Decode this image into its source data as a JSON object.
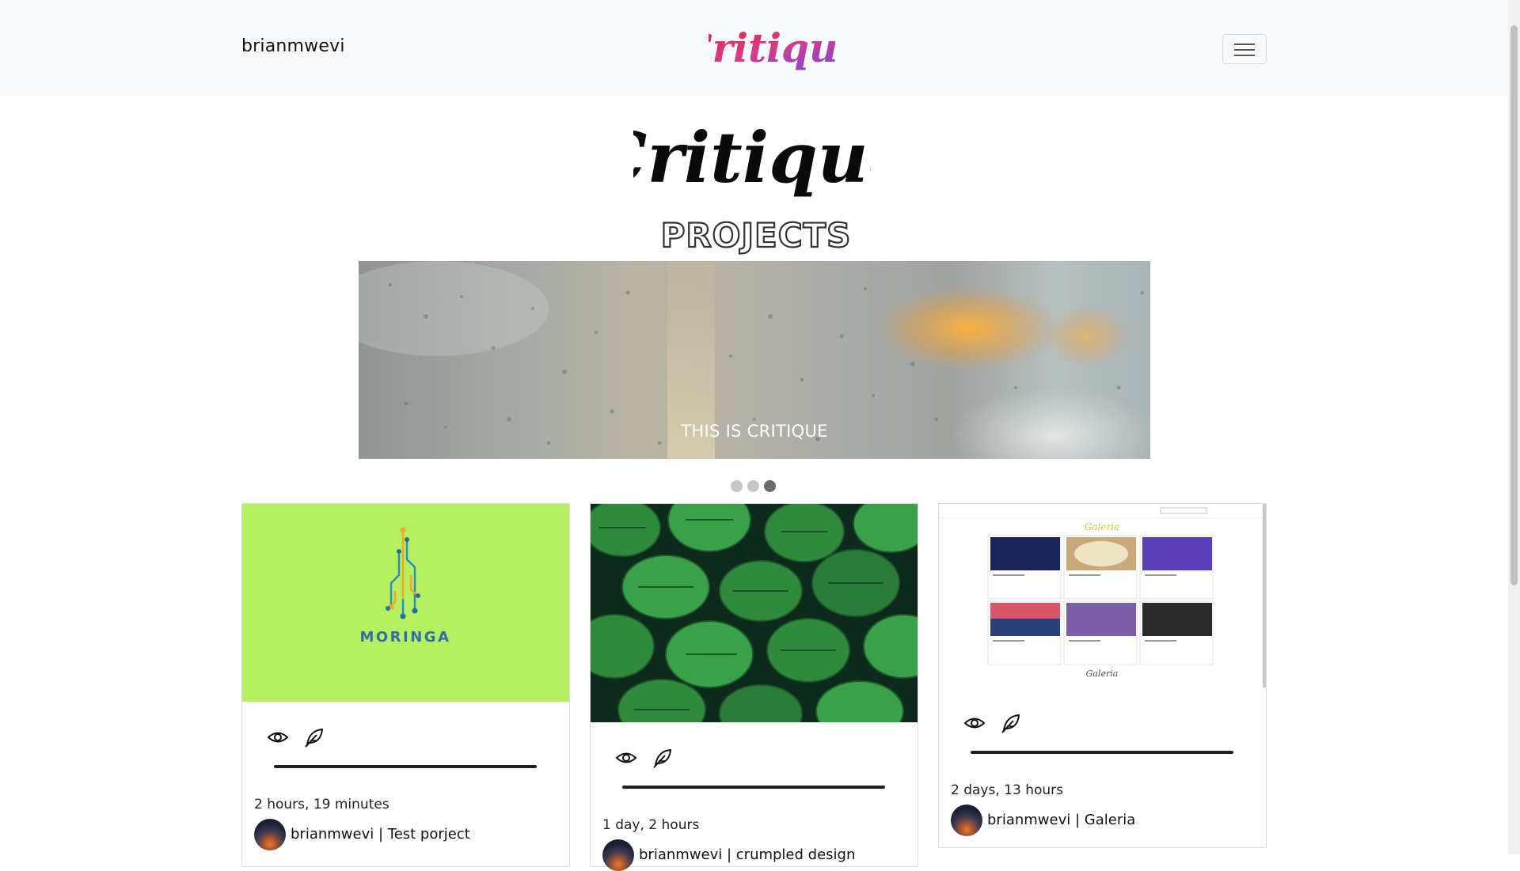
{
  "navbar": {
    "username": "brianmwevi",
    "logo_text": "Critique"
  },
  "hero": {
    "title": "Critique",
    "subtitle": "PROJECTS"
  },
  "carousel": {
    "caption": "THIS IS CRITIQUE",
    "slide_count": 3,
    "active_slide": 3
  },
  "projects": [
    {
      "image_text": "MORINGA",
      "time": "2 hours, 19 minutes",
      "author": "brianmwevi",
      "separator": " | ",
      "title": "Test porject"
    },
    {
      "time": "1 day, 2 hours",
      "author": "brianmwevi",
      "separator": " | ",
      "title": "crumpled design"
    },
    {
      "image_text": "Galeria",
      "time": "2 days, 13 hours",
      "author": "brianmwevi",
      "separator": " | ",
      "title": "Galeria"
    }
  ],
  "icons": {
    "view": "eye-icon",
    "review": "feather-icon",
    "menu": "hamburger-icon"
  },
  "colors": {
    "navbar_bg": "#f8f9fa",
    "moringa_bg": "#b4f05f",
    "logo_gradient_start": "#e8253a",
    "logo_gradient_end": "#6a4cf0"
  }
}
